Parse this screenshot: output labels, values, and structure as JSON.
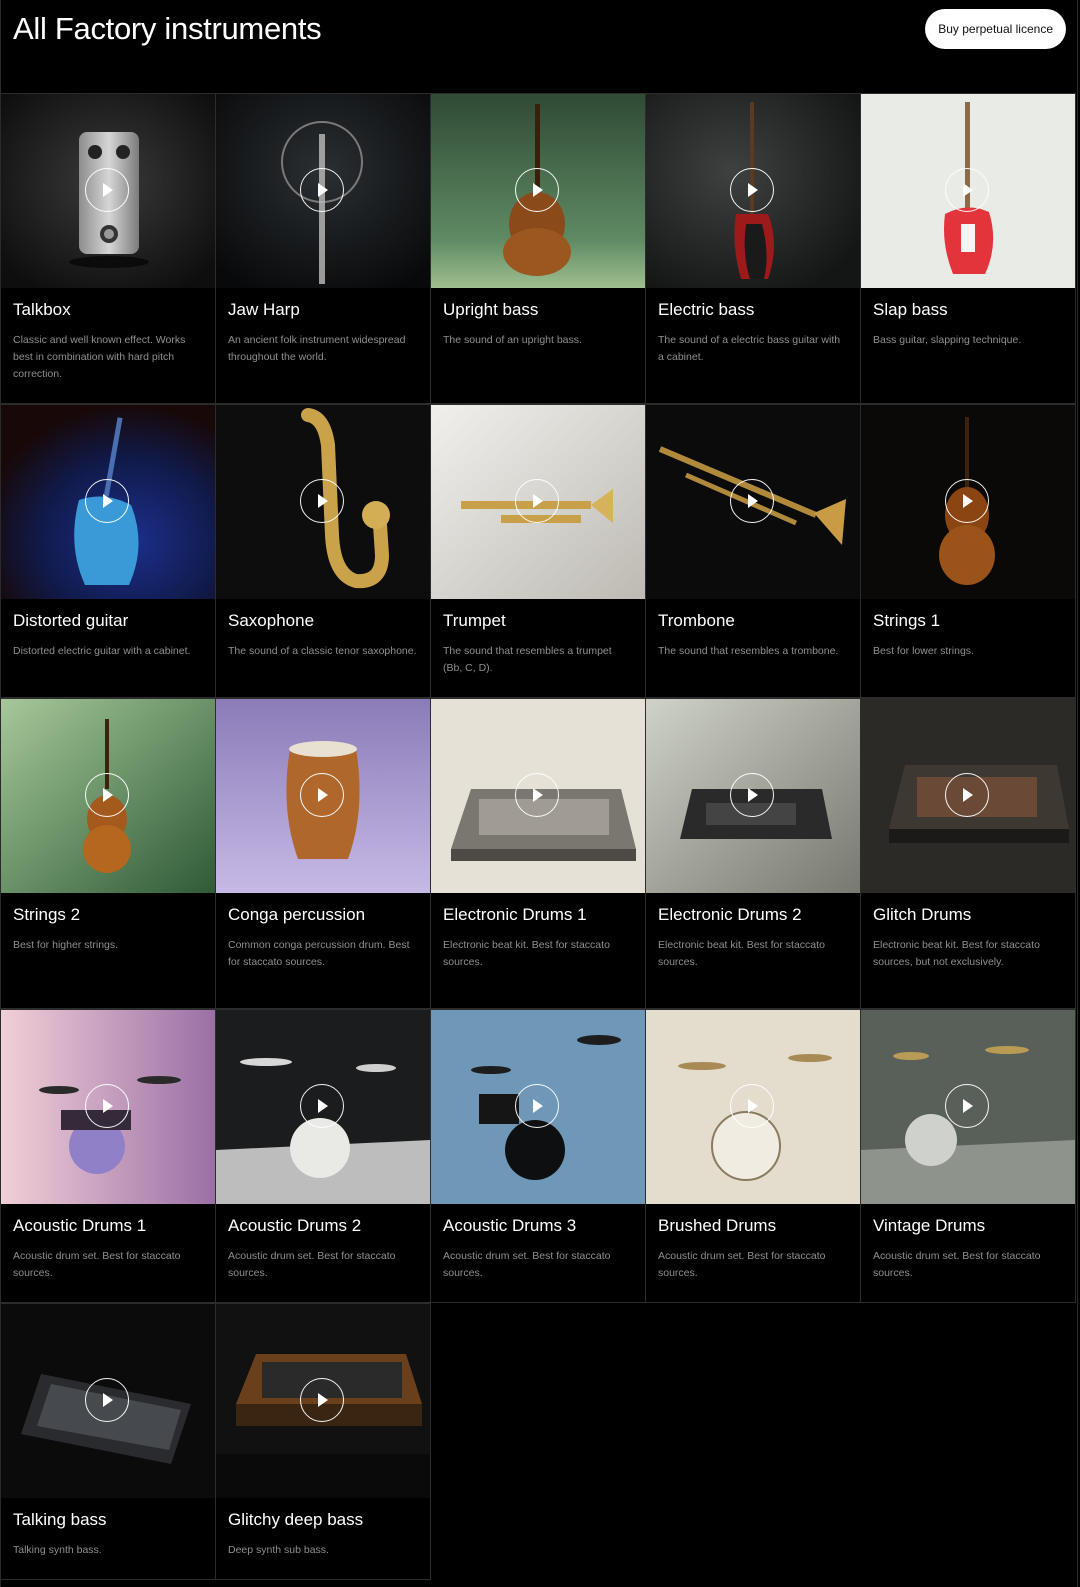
{
  "header": {
    "title": "All Factory instruments",
    "buy_label": "Buy perpetual licence"
  },
  "instruments": [
    {
      "name": "Talkbox",
      "description": "Classic and well known effect. Works best in combination with hard pitch correction.",
      "icon": "play-icon"
    },
    {
      "name": "Jaw Harp",
      "description": "An ancient folk instrument widespread throughout the world.",
      "icon": "play-icon"
    },
    {
      "name": "Upright bass",
      "description": "The sound of an upright bass.",
      "icon": "play-icon"
    },
    {
      "name": "Electric bass",
      "description": "The sound of a electric bass guitar with a cabinet.",
      "icon": "play-icon"
    },
    {
      "name": "Slap bass",
      "description": "Bass guitar, slapping technique.",
      "icon": "play-icon"
    },
    {
      "name": "Distorted guitar",
      "description": "Distorted electric guitar with a cabinet.",
      "icon": "play-icon"
    },
    {
      "name": "Saxophone",
      "description": "The sound of a classic tenor saxophone.",
      "icon": "play-icon"
    },
    {
      "name": "Trumpet",
      "description": "The sound that resembles a trumpet (Bb, C, D).",
      "icon": "play-icon"
    },
    {
      "name": "Trombone",
      "description": "The sound that resembles a trombone.",
      "icon": "play-icon"
    },
    {
      "name": "Strings 1",
      "description": "Best for lower strings.",
      "icon": "play-icon"
    },
    {
      "name": "Strings 2",
      "description": "Best for higher strings.",
      "icon": "play-icon"
    },
    {
      "name": "Conga percussion",
      "description": "Common conga percussion drum. Best for staccato sources.",
      "icon": "play-icon"
    },
    {
      "name": "Electronic Drums 1",
      "description": "Electronic beat kit. Best for staccato sources.",
      "icon": "play-icon"
    },
    {
      "name": "Electronic Drums 2",
      "description": "Electronic beat kit. Best for staccato sources.",
      "icon": "play-icon"
    },
    {
      "name": "Glitch Drums",
      "description": "Electronic beat kit. Best for staccato sources, but not exclusively.",
      "icon": "play-icon"
    },
    {
      "name": "Acoustic Drums 1",
      "description": "Acoustic drum set. Best for staccato sources.",
      "icon": "play-icon"
    },
    {
      "name": "Acoustic Drums 2",
      "description": "Acoustic drum set. Best for staccato sources.",
      "icon": "play-icon"
    },
    {
      "name": "Acoustic Drums 3",
      "description": "Acoustic drum set. Best for staccato sources.",
      "icon": "play-icon"
    },
    {
      "name": "Brushed Drums",
      "description": "Acoustic drum set. Best for staccato sources.",
      "icon": "play-icon"
    },
    {
      "name": "Vintage Drums",
      "description": "Acoustic drum set. Best for staccato sources.",
      "icon": "play-icon"
    },
    {
      "name": "Talking bass",
      "description": "Talking synth bass.",
      "icon": "play-icon"
    },
    {
      "name": "Glitchy deep bass",
      "description": "Deep synth sub bass.",
      "icon": "play-icon"
    }
  ]
}
